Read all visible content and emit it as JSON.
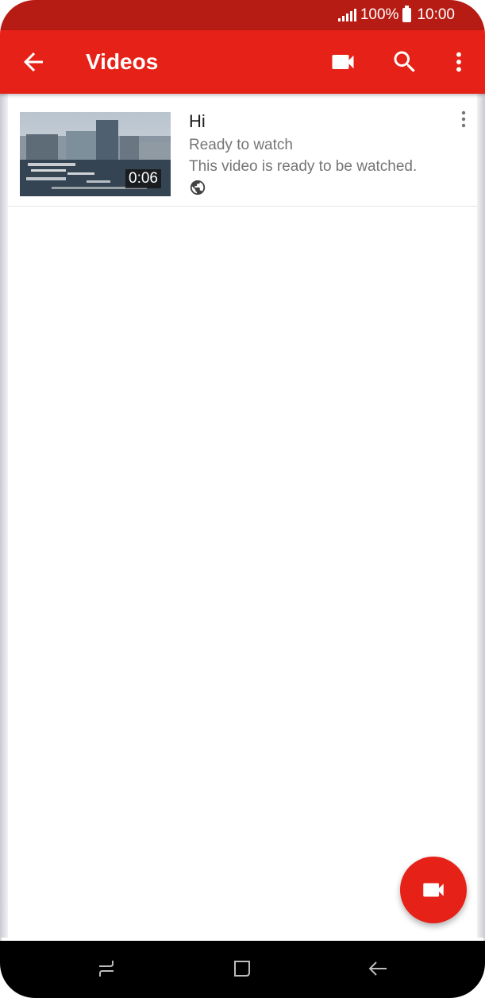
{
  "status_bar": {
    "battery_percent": "100%",
    "time": "10:00"
  },
  "app_bar": {
    "title": "Videos",
    "color": "#e62117"
  },
  "videos": [
    {
      "title": "Hi",
      "status": "Ready to watch",
      "description": "This video is ready to be watched.",
      "duration": "0:06",
      "privacy_icon": "globe-icon"
    }
  ],
  "fab": {
    "icon": "video-camera-icon",
    "color": "#e62117"
  },
  "nav_bar": {
    "icons": [
      "recent-apps-icon",
      "home-icon",
      "back-icon"
    ]
  }
}
